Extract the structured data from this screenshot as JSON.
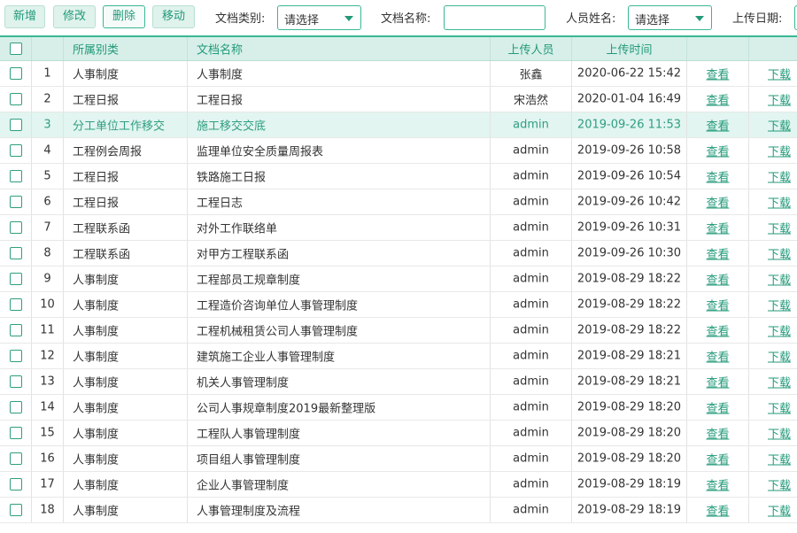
{
  "toolbar": {
    "add_label": "新增",
    "edit_label": "修改",
    "delete_label": "删除",
    "move_label": "移动",
    "category_label": "文档类别:",
    "category_value": "请选择",
    "docname_label": "文档名称:",
    "docname_value": "",
    "person_label": "人员姓名:",
    "person_value": "请选择",
    "date_label": "上传日期:"
  },
  "table": {
    "headers": {
      "category": "所属别类",
      "name": "文档名称",
      "uploader": "上传人员",
      "time": "上传时间"
    },
    "rows": [
      {
        "no": "1",
        "category": "人事制度",
        "name": "人事制度",
        "uploader": "张鑫",
        "time": "2020-06-22 15:42",
        "view": "查看",
        "download": "下载"
      },
      {
        "no": "2",
        "category": "工程日报",
        "name": "工程日报",
        "uploader": "宋浩然",
        "time": "2020-01-04 16:49",
        "view": "查看",
        "download": "下载"
      },
      {
        "no": "3",
        "category": "分工单位工作移交",
        "name": "施工移交交底",
        "uploader": "admin",
        "time": "2019-09-26 11:53",
        "view": "查看",
        "download": "下载"
      },
      {
        "no": "4",
        "category": "工程例会周报",
        "name": "监理单位安全质量周报表",
        "uploader": "admin",
        "time": "2019-09-26 10:58",
        "view": "查看",
        "download": "下载"
      },
      {
        "no": "5",
        "category": "工程日报",
        "name": "铁路施工日报",
        "uploader": "admin",
        "time": "2019-09-26 10:54",
        "view": "查看",
        "download": "下载"
      },
      {
        "no": "6",
        "category": "工程日报",
        "name": "工程日志",
        "uploader": "admin",
        "time": "2019-09-26 10:42",
        "view": "查看",
        "download": "下载"
      },
      {
        "no": "7",
        "category": "工程联系函",
        "name": "对外工作联络单",
        "uploader": "admin",
        "time": "2019-09-26 10:31",
        "view": "查看",
        "download": "下载"
      },
      {
        "no": "8",
        "category": "工程联系函",
        "name": "对甲方工程联系函",
        "uploader": "admin",
        "time": "2019-09-26 10:30",
        "view": "查看",
        "download": "下载"
      },
      {
        "no": "9",
        "category": "人事制度",
        "name": "工程部员工规章制度",
        "uploader": "admin",
        "time": "2019-08-29 18:22",
        "view": "查看",
        "download": "下载"
      },
      {
        "no": "10",
        "category": "人事制度",
        "name": "工程造价咨询单位人事管理制度",
        "uploader": "admin",
        "time": "2019-08-29 18:22",
        "view": "查看",
        "download": "下载"
      },
      {
        "no": "11",
        "category": "人事制度",
        "name": "工程机械租赁公司人事管理制度",
        "uploader": "admin",
        "time": "2019-08-29 18:22",
        "view": "查看",
        "download": "下载"
      },
      {
        "no": "12",
        "category": "人事制度",
        "name": "建筑施工企业人事管理制度",
        "uploader": "admin",
        "time": "2019-08-29 18:21",
        "view": "查看",
        "download": "下载"
      },
      {
        "no": "13",
        "category": "人事制度",
        "name": "机关人事管理制度",
        "uploader": "admin",
        "time": "2019-08-29 18:21",
        "view": "查看",
        "download": "下载"
      },
      {
        "no": "14",
        "category": "人事制度",
        "name": "公司人事规章制度2019最新整理版",
        "uploader": "admin",
        "time": "2019-08-29 18:20",
        "view": "查看",
        "download": "下载"
      },
      {
        "no": "15",
        "category": "人事制度",
        "name": "工程队人事管理制度",
        "uploader": "admin",
        "time": "2019-08-29 18:20",
        "view": "查看",
        "download": "下载"
      },
      {
        "no": "16",
        "category": "人事制度",
        "name": "项目组人事管理制度",
        "uploader": "admin",
        "time": "2019-08-29 18:20",
        "view": "查看",
        "download": "下载"
      },
      {
        "no": "17",
        "category": "人事制度",
        "name": "企业人事管理制度",
        "uploader": "admin",
        "time": "2019-08-29 18:19",
        "view": "查看",
        "download": "下载"
      },
      {
        "no": "18",
        "category": "人事制度",
        "name": "人事管理制度及流程",
        "uploader": "admin",
        "time": "2019-08-29 18:19",
        "view": "查看",
        "download": "下载"
      }
    ]
  },
  "colors": {
    "accent": "#3ab795",
    "accent_text": "#239a7a",
    "header_bg": "#d7efe8",
    "selected_row_bg": "#e2f5f0"
  }
}
